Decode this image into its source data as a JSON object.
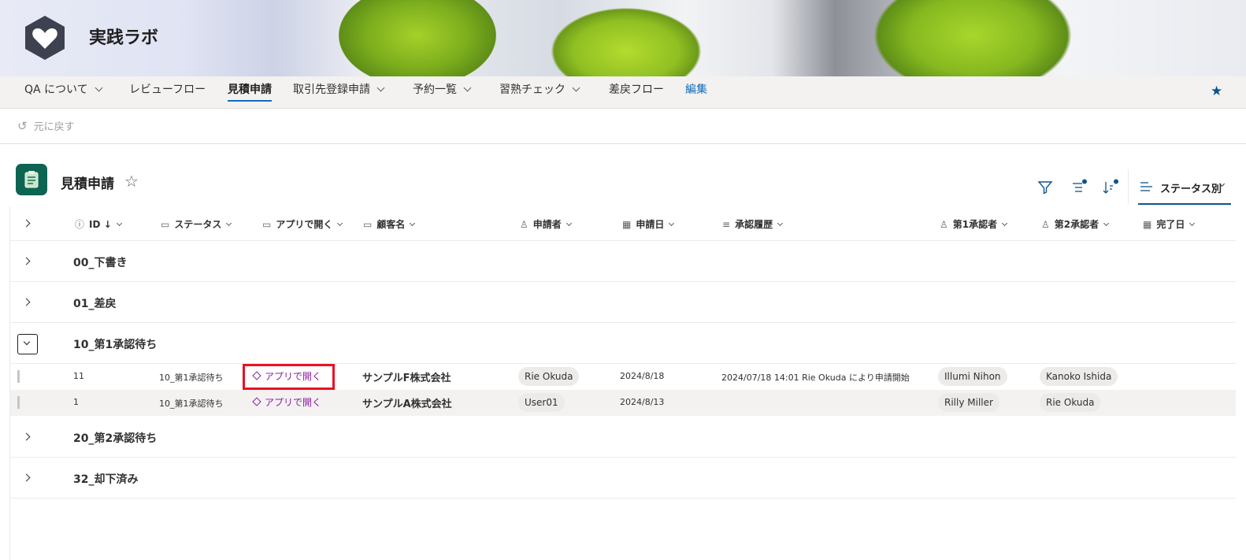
{
  "site": {
    "title": "実践ラボ"
  },
  "nav": {
    "items": [
      {
        "label": "QA について",
        "dropdown": true
      },
      {
        "label": "レビューフロー",
        "dropdown": false
      },
      {
        "label": "見積申請",
        "dropdown": false,
        "active": true
      },
      {
        "label": "取引先登録申請",
        "dropdown": true
      },
      {
        "label": "予約一覧",
        "dropdown": true
      },
      {
        "label": "習熟チェック",
        "dropdown": true
      },
      {
        "label": "差戻フロー",
        "dropdown": false
      }
    ],
    "edit_label": "編集"
  },
  "command_bar": {
    "undo_label": "元に戻す"
  },
  "list": {
    "title": "見積申請"
  },
  "toolbar": {
    "view_label": "ステータス別"
  },
  "columns": [
    "ID ↓",
    "ステータス",
    "アプリで開く",
    "顧客名",
    "申請者",
    "申請日",
    "承認履歴",
    "第1承認者",
    "第2承認者",
    "完了日"
  ],
  "groups": [
    {
      "name": "00_下書き",
      "expanded": false
    },
    {
      "name": "01_差戻",
      "expanded": false
    },
    {
      "name": "10_第1承認待ち",
      "expanded": true,
      "rows": [
        {
          "id": "11",
          "status": "10_第1承認待ち",
          "app_link": "アプリで開く",
          "customer": "サンプルF株式会社",
          "applicant": "Rie Okuda",
          "date": "2024/8/18",
          "history": "2024/07/18 14:01 Rie Okuda により申請開始",
          "approver1": "Illumi Nihon",
          "approver2": "Kanoko Ishida",
          "done": ""
        },
        {
          "id": "1",
          "status": "10_第1承認待ち",
          "app_link": "アプリで開く",
          "customer": "サンプルA株式会社",
          "applicant": "User01",
          "date": "2024/8/13",
          "history": "",
          "approver1": "Rilly Miller",
          "approver2": "Rie Okuda",
          "done": ""
        }
      ]
    },
    {
      "name": "20_第2承認待ち",
      "expanded": false
    },
    {
      "name": "32_却下済み",
      "expanded": false
    }
  ],
  "colors": {
    "accent": "#0f548c",
    "list_icon": "#0c6451",
    "app_link": "#8b1ea0",
    "highlight": "#e81123"
  }
}
